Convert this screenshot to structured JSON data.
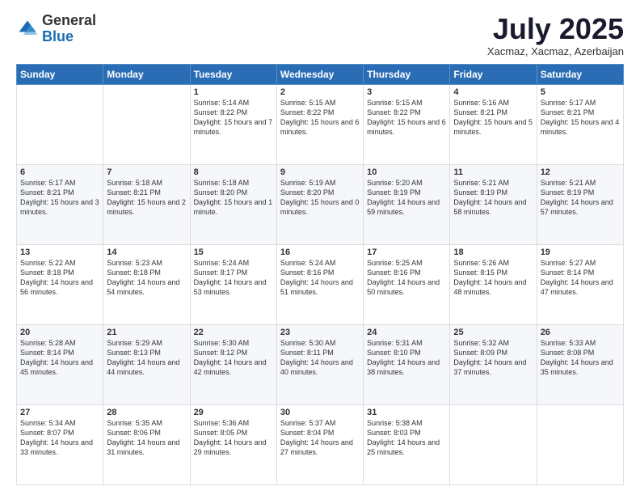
{
  "header": {
    "logo": {
      "line1": "General",
      "line2": "Blue"
    },
    "title": "July 2025",
    "subtitle": "Xacmaz, Xacmaz, Azerbaijan"
  },
  "weekdays": [
    "Sunday",
    "Monday",
    "Tuesday",
    "Wednesday",
    "Thursday",
    "Friday",
    "Saturday"
  ],
  "weeks": [
    [
      {
        "day": "",
        "sunrise": "",
        "sunset": "",
        "daylight": ""
      },
      {
        "day": "",
        "sunrise": "",
        "sunset": "",
        "daylight": ""
      },
      {
        "day": "1",
        "sunrise": "Sunrise: 5:14 AM",
        "sunset": "Sunset: 8:22 PM",
        "daylight": "Daylight: 15 hours and 7 minutes."
      },
      {
        "day": "2",
        "sunrise": "Sunrise: 5:15 AM",
        "sunset": "Sunset: 8:22 PM",
        "daylight": "Daylight: 15 hours and 6 minutes."
      },
      {
        "day": "3",
        "sunrise": "Sunrise: 5:15 AM",
        "sunset": "Sunset: 8:22 PM",
        "daylight": "Daylight: 15 hours and 6 minutes."
      },
      {
        "day": "4",
        "sunrise": "Sunrise: 5:16 AM",
        "sunset": "Sunset: 8:21 PM",
        "daylight": "Daylight: 15 hours and 5 minutes."
      },
      {
        "day": "5",
        "sunrise": "Sunrise: 5:17 AM",
        "sunset": "Sunset: 8:21 PM",
        "daylight": "Daylight: 15 hours and 4 minutes."
      }
    ],
    [
      {
        "day": "6",
        "sunrise": "Sunrise: 5:17 AM",
        "sunset": "Sunset: 8:21 PM",
        "daylight": "Daylight: 15 hours and 3 minutes."
      },
      {
        "day": "7",
        "sunrise": "Sunrise: 5:18 AM",
        "sunset": "Sunset: 8:21 PM",
        "daylight": "Daylight: 15 hours and 2 minutes."
      },
      {
        "day": "8",
        "sunrise": "Sunrise: 5:18 AM",
        "sunset": "Sunset: 8:20 PM",
        "daylight": "Daylight: 15 hours and 1 minute."
      },
      {
        "day": "9",
        "sunrise": "Sunrise: 5:19 AM",
        "sunset": "Sunset: 8:20 PM",
        "daylight": "Daylight: 15 hours and 0 minutes."
      },
      {
        "day": "10",
        "sunrise": "Sunrise: 5:20 AM",
        "sunset": "Sunset: 8:19 PM",
        "daylight": "Daylight: 14 hours and 59 minutes."
      },
      {
        "day": "11",
        "sunrise": "Sunrise: 5:21 AM",
        "sunset": "Sunset: 8:19 PM",
        "daylight": "Daylight: 14 hours and 58 minutes."
      },
      {
        "day": "12",
        "sunrise": "Sunrise: 5:21 AM",
        "sunset": "Sunset: 8:19 PM",
        "daylight": "Daylight: 14 hours and 57 minutes."
      }
    ],
    [
      {
        "day": "13",
        "sunrise": "Sunrise: 5:22 AM",
        "sunset": "Sunset: 8:18 PM",
        "daylight": "Daylight: 14 hours and 56 minutes."
      },
      {
        "day": "14",
        "sunrise": "Sunrise: 5:23 AM",
        "sunset": "Sunset: 8:18 PM",
        "daylight": "Daylight: 14 hours and 54 minutes."
      },
      {
        "day": "15",
        "sunrise": "Sunrise: 5:24 AM",
        "sunset": "Sunset: 8:17 PM",
        "daylight": "Daylight: 14 hours and 53 minutes."
      },
      {
        "day": "16",
        "sunrise": "Sunrise: 5:24 AM",
        "sunset": "Sunset: 8:16 PM",
        "daylight": "Daylight: 14 hours and 51 minutes."
      },
      {
        "day": "17",
        "sunrise": "Sunrise: 5:25 AM",
        "sunset": "Sunset: 8:16 PM",
        "daylight": "Daylight: 14 hours and 50 minutes."
      },
      {
        "day": "18",
        "sunrise": "Sunrise: 5:26 AM",
        "sunset": "Sunset: 8:15 PM",
        "daylight": "Daylight: 14 hours and 48 minutes."
      },
      {
        "day": "19",
        "sunrise": "Sunrise: 5:27 AM",
        "sunset": "Sunset: 8:14 PM",
        "daylight": "Daylight: 14 hours and 47 minutes."
      }
    ],
    [
      {
        "day": "20",
        "sunrise": "Sunrise: 5:28 AM",
        "sunset": "Sunset: 8:14 PM",
        "daylight": "Daylight: 14 hours and 45 minutes."
      },
      {
        "day": "21",
        "sunrise": "Sunrise: 5:29 AM",
        "sunset": "Sunset: 8:13 PM",
        "daylight": "Daylight: 14 hours and 44 minutes."
      },
      {
        "day": "22",
        "sunrise": "Sunrise: 5:30 AM",
        "sunset": "Sunset: 8:12 PM",
        "daylight": "Daylight: 14 hours and 42 minutes."
      },
      {
        "day": "23",
        "sunrise": "Sunrise: 5:30 AM",
        "sunset": "Sunset: 8:11 PM",
        "daylight": "Daylight: 14 hours and 40 minutes."
      },
      {
        "day": "24",
        "sunrise": "Sunrise: 5:31 AM",
        "sunset": "Sunset: 8:10 PM",
        "daylight": "Daylight: 14 hours and 38 minutes."
      },
      {
        "day": "25",
        "sunrise": "Sunrise: 5:32 AM",
        "sunset": "Sunset: 8:09 PM",
        "daylight": "Daylight: 14 hours and 37 minutes."
      },
      {
        "day": "26",
        "sunrise": "Sunrise: 5:33 AM",
        "sunset": "Sunset: 8:08 PM",
        "daylight": "Daylight: 14 hours and 35 minutes."
      }
    ],
    [
      {
        "day": "27",
        "sunrise": "Sunrise: 5:34 AM",
        "sunset": "Sunset: 8:07 PM",
        "daylight": "Daylight: 14 hours and 33 minutes."
      },
      {
        "day": "28",
        "sunrise": "Sunrise: 5:35 AM",
        "sunset": "Sunset: 8:06 PM",
        "daylight": "Daylight: 14 hours and 31 minutes."
      },
      {
        "day": "29",
        "sunrise": "Sunrise: 5:36 AM",
        "sunset": "Sunset: 8:05 PM",
        "daylight": "Daylight: 14 hours and 29 minutes."
      },
      {
        "day": "30",
        "sunrise": "Sunrise: 5:37 AM",
        "sunset": "Sunset: 8:04 PM",
        "daylight": "Daylight: 14 hours and 27 minutes."
      },
      {
        "day": "31",
        "sunrise": "Sunrise: 5:38 AM",
        "sunset": "Sunset: 8:03 PM",
        "daylight": "Daylight: 14 hours and 25 minutes."
      },
      {
        "day": "",
        "sunrise": "",
        "sunset": "",
        "daylight": ""
      },
      {
        "day": "",
        "sunrise": "",
        "sunset": "",
        "daylight": ""
      }
    ]
  ]
}
